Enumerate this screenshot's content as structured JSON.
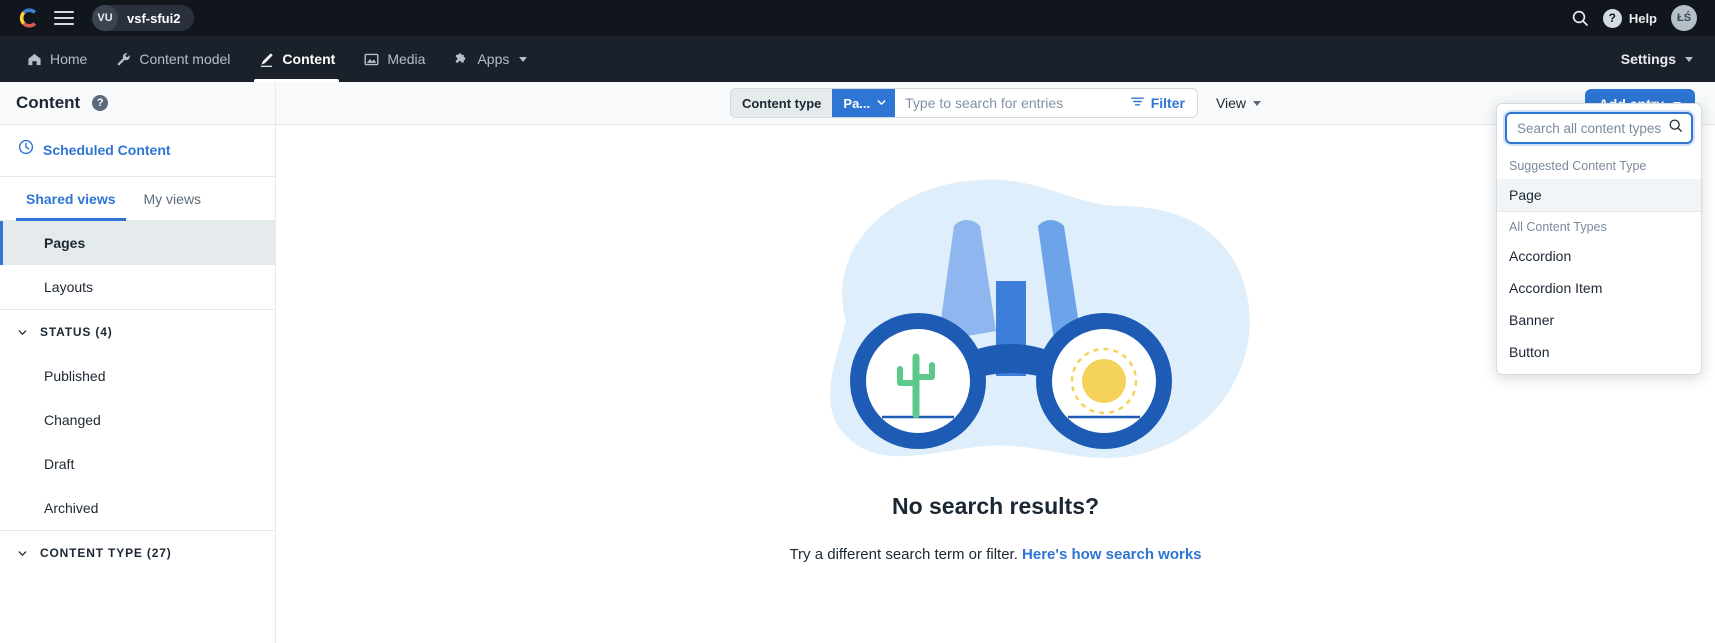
{
  "topbar": {
    "logo_icon": "contentful-logo-icon",
    "menu_icon": "hamburger-menu-icon",
    "space_initials": "VU",
    "space_name": "vsf-sfui2",
    "search_icon": "search-icon",
    "help_icon": "question-mark-icon",
    "help_label": "Help",
    "user_initials": "ŁŚ"
  },
  "nav": {
    "items": [
      {
        "label": "Home",
        "icon": "home-icon",
        "active": false,
        "caret": false
      },
      {
        "label": "Content model",
        "icon": "wrench-icon",
        "active": false,
        "caret": false
      },
      {
        "label": "Content",
        "icon": "pen-icon",
        "active": true,
        "caret": false
      },
      {
        "label": "Media",
        "icon": "image-icon",
        "active": false,
        "caret": false
      },
      {
        "label": "Apps",
        "icon": "puzzle-icon",
        "active": false,
        "caret": true
      }
    ],
    "settings_label": "Settings",
    "settings_caret_icon": "chevron-down-icon"
  },
  "sidebar": {
    "title": "Content",
    "help_icon": "question-mark-icon",
    "scheduled": {
      "label": "Scheduled Content",
      "icon": "clock-icon"
    },
    "tabs": [
      {
        "label": "Shared views",
        "active": true
      },
      {
        "label": "My views",
        "active": false
      }
    ],
    "views": [
      {
        "label": "Pages",
        "selected": true
      },
      {
        "label": "Layouts",
        "selected": false
      }
    ],
    "sections": [
      {
        "heading": "STATUS (4)",
        "icon": "chevron-down-icon",
        "items": [
          "Published",
          "Changed",
          "Draft",
          "Archived"
        ]
      },
      {
        "heading": "CONTENT TYPE (27)",
        "icon": "chevron-down-icon",
        "items": []
      }
    ]
  },
  "toolbar": {
    "content_type_label": "Content type",
    "content_type_value": "Pa...",
    "content_type_caret_icon": "chevron-down-icon",
    "search_placeholder": "Type to search for entries",
    "search_value": "",
    "filter_label": "Filter",
    "filter_icon": "filter-icon",
    "view_label": "View",
    "view_caret_icon": "chevron-down-icon",
    "add_entry_label": "Add entry",
    "add_entry_caret_icon": "chevron-down-icon"
  },
  "empty_state": {
    "illustration": "binoculars-illustration",
    "title": "No search results?",
    "subtitle_prefix": "Try a different search term or filter.",
    "link_label": "Here's how search works"
  },
  "content_type_dropdown": {
    "search_placeholder": "Search all content types",
    "search_value": "",
    "search_icon": "search-icon",
    "suggested_label": "Suggested Content Type",
    "suggested": [
      {
        "label": "Page",
        "highlighted": true
      }
    ],
    "all_label": "All Content Types",
    "all": [
      {
        "label": "Accordion",
        "highlighted": false
      },
      {
        "label": "Accordion Item",
        "highlighted": false
      },
      {
        "label": "Banner",
        "highlighted": false
      },
      {
        "label": "Button",
        "highlighted": false
      }
    ]
  },
  "colors": {
    "accent_blue": "#2e75d4",
    "topbar_dark": "#11151c",
    "navbar_dark": "#1b212b",
    "panel_gray": "#f7f9fa",
    "illus_dark_blue": "#1e5bb5",
    "illus_mid_blue": "#3d7edb",
    "illus_light_blue": "#7aa8ec",
    "illus_green": "#5cc98a",
    "illus_yellow": "#f5d259"
  }
}
